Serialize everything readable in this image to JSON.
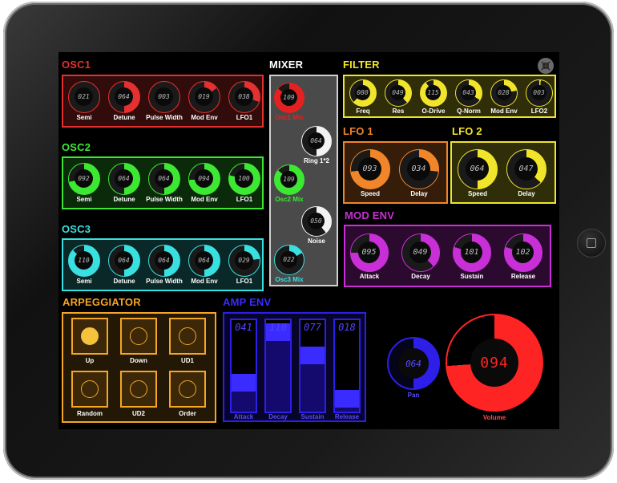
{
  "osc1": {
    "title": "OSC1",
    "color": "#e53030",
    "knobs": [
      {
        "label": "Semi",
        "value": "021",
        "level": 0.0
      },
      {
        "label": "Detune",
        "value": "064",
        "level": 0.5
      },
      {
        "label": "Pulse Width",
        "value": "003",
        "level": 0.0
      },
      {
        "label": "Mod Env",
        "value": "019",
        "level": 0.15
      },
      {
        "label": "LFO1",
        "value": "038",
        "level": 0.3
      }
    ]
  },
  "osc2": {
    "title": "OSC2",
    "color": "#3de833",
    "knobs": [
      {
        "label": "Semi",
        "value": "092",
        "level": 0.72
      },
      {
        "label": "Detune",
        "value": "064",
        "level": 0.5
      },
      {
        "label": "Pulse Width",
        "value": "064",
        "level": 0.5
      },
      {
        "label": "Mod Env",
        "value": "094",
        "level": 0.74
      },
      {
        "label": "LFO1",
        "value": "100",
        "level": 0.79
      }
    ]
  },
  "osc3": {
    "title": "OSC3",
    "color": "#39e0e0",
    "knobs": [
      {
        "label": "Semi",
        "value": "110",
        "level": 0.87
      },
      {
        "label": "Detune",
        "value": "064",
        "level": 0.5
      },
      {
        "label": "Pulse Width",
        "value": "064",
        "level": 0.5
      },
      {
        "label": "Mod Env",
        "value": "064",
        "level": 0.5
      },
      {
        "label": "LFO1",
        "value": "029",
        "level": 0.23
      }
    ]
  },
  "mixer": {
    "title": "MIXER",
    "knobs": [
      {
        "label": "Osc1 Mix",
        "value": "109",
        "level": 0.86,
        "color": "#e52020"
      },
      {
        "label": "Ring 1*2",
        "value": "064",
        "level": 0.5,
        "color": "#f2f2f2"
      },
      {
        "label": "Osc2 Mix",
        "value": "109",
        "level": 0.86,
        "color": "#3de833"
      },
      {
        "label": "Noise",
        "value": "050",
        "level": 0.39,
        "color": "#f2f2f2"
      },
      {
        "label": "Osc3 Mix",
        "value": "022",
        "level": 0.17,
        "color": "#39e0e0"
      }
    ]
  },
  "filter": {
    "title": "FILTER",
    "color": "#f0e52a",
    "knobs": [
      {
        "label": "Freq",
        "value": "080",
        "level": 0.63
      },
      {
        "label": "Res",
        "value": "049",
        "level": 0.38
      },
      {
        "label": "O-Drive",
        "value": "115",
        "level": 0.9
      },
      {
        "label": "Q-Norm",
        "value": "043",
        "level": 0.34
      },
      {
        "label": "Mod Env",
        "value": "028",
        "level": 0.22
      },
      {
        "label": "LFO2",
        "value": "003",
        "level": 0.02
      }
    ]
  },
  "lfo1": {
    "title": "LFO 1",
    "color": "#f0852a",
    "knobs": [
      {
        "label": "Speed",
        "value": "093",
        "level": 0.73
      },
      {
        "label": "Delay",
        "value": "034",
        "level": 0.27
      }
    ]
  },
  "lfo2": {
    "title": "LFO 2",
    "color": "#f0e52a",
    "knobs": [
      {
        "label": "Speed",
        "value": "064",
        "level": 0.5
      },
      {
        "label": "Delay",
        "value": "047",
        "level": 0.37
      }
    ]
  },
  "modenv": {
    "title": "MOD ENV",
    "color": "#c92fd6",
    "knobs": [
      {
        "label": "Attack",
        "value": "095",
        "level": 0.75
      },
      {
        "label": "Decay",
        "value": "049",
        "level": 0.38
      },
      {
        "label": "Sustain",
        "value": "101",
        "level": 0.8
      },
      {
        "label": "Release",
        "value": "102",
        "level": 0.8
      }
    ]
  },
  "arp": {
    "title": "ARPEGGIATOR",
    "color": "#f5a623",
    "buttons": [
      {
        "label": "Up",
        "active": true
      },
      {
        "label": "Down",
        "active": false
      },
      {
        "label": "UD1",
        "active": false
      },
      {
        "label": "Random",
        "active": false
      },
      {
        "label": "UD2",
        "active": false
      },
      {
        "label": "Order",
        "active": false
      }
    ]
  },
  "ampenv": {
    "title": "AMP ENV",
    "color": "#2d1ee8",
    "faders": [
      {
        "label": "Attack",
        "value": "041",
        "level": 0.32
      },
      {
        "label": "Decay",
        "value": "110",
        "level": 0.87
      },
      {
        "label": "Sustain",
        "value": "077",
        "level": 0.61
      },
      {
        "label": "Release",
        "value": "018",
        "level": 0.14
      }
    ]
  },
  "pan": {
    "label": "Pan",
    "value": "064",
    "level": 0.5,
    "color": "#2d1ee8"
  },
  "volume": {
    "label": "Volume",
    "value": "094",
    "level": 0.74,
    "color": "#ff2424"
  },
  "icons": {
    "collapse": "collapse-arrows-icon",
    "home": "home-button-icon"
  }
}
